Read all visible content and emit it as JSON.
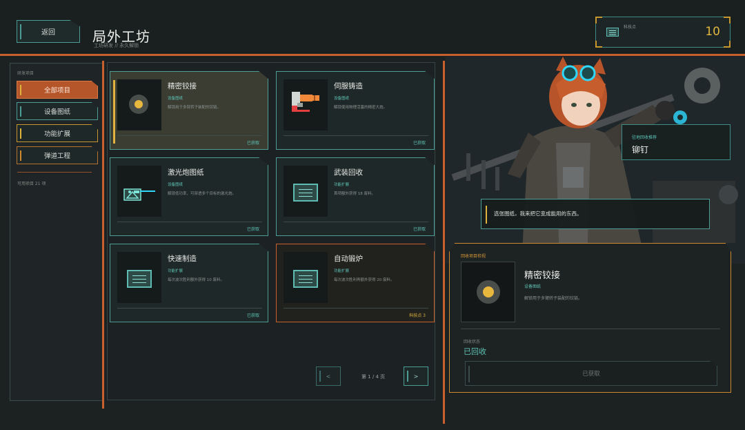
{
  "header": {
    "back_label": "返回",
    "title": "局外工坊",
    "subtitle": "工坊研发 // 永久解锁",
    "points_label": "科技点",
    "points_value": "10"
  },
  "sidebar": {
    "section_label": "研发项目",
    "items": [
      {
        "label": "全部项目",
        "active": true,
        "marker": "#e0b43c"
      },
      {
        "label": "设备图纸",
        "active": false,
        "marker": "#4d9d97"
      },
      {
        "label": "功能扩展",
        "active": false,
        "marker": "#e0b43c"
      },
      {
        "label": "弹道工程",
        "active": false,
        "marker": "#d08a2e"
      }
    ],
    "count_text": "可用项目 21 项"
  },
  "cards": [
    {
      "name": "精密铰接",
      "category": "设备图纸",
      "desc": "解锁用于多臂转子装配的铰链。",
      "status": "已获取",
      "icon": "gear-circle-icon"
    },
    {
      "name": "伺服铸造",
      "category": "设备图纸",
      "desc": "解锁使用物理活塞的精密大炮。",
      "status": "已获取",
      "icon": "cannon-icon"
    },
    {
      "name": "激光炮图纸",
      "category": "设备图纸",
      "desc": "解锁低功率、可穿透多个目标的激光炮。",
      "status": "已获取",
      "icon": "laser-cannon-icon"
    },
    {
      "name": "武装回收",
      "category": "功能扩展",
      "desc": "首项额外获得 18 废料。",
      "status": "已获取",
      "icon": "document-icon"
    },
    {
      "name": "快速制造",
      "category": "功能扩展",
      "desc": "每次波次胜利额外获得 10 废料。",
      "status": "已获取",
      "icon": "document-icon"
    },
    {
      "name": "自动锻炉",
      "category": "功能扩展",
      "desc": "每次波次胜利再额外获得 20 废料。",
      "status": "科技点 3",
      "icon": "document-icon"
    }
  ],
  "pager": {
    "prev": "<",
    "next": ">",
    "text": "第 1 / 4 页"
  },
  "right": {
    "recommend_label": "驻地回收推荐",
    "recommend_name": "铆钉",
    "dialog": "选张图纸，我来把它变成能用的东西。",
    "detail": {
      "label": "回收项目检视",
      "name": "精密铰接",
      "category": "设备图纸",
      "desc": "解锁用于多臂转子装配的铰链。",
      "state_label": "回收状态",
      "state": "已回收",
      "button": "已获取"
    }
  },
  "colors": {
    "accent_orange": "#c8612e",
    "accent_teal": "#4d9d97",
    "accent_gold": "#e0b43c"
  }
}
